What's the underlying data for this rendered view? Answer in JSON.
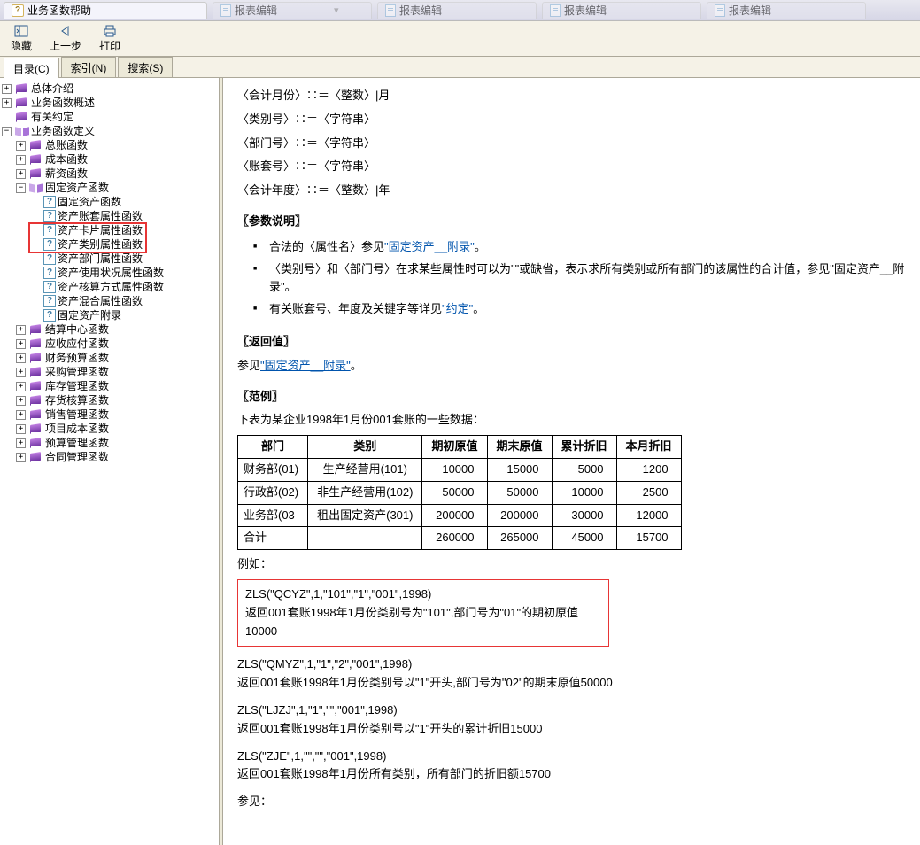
{
  "title": "业务函数帮助",
  "tabs_top": [
    "报表编辑",
    "报表编辑",
    "报表编辑",
    "报表编辑"
  ],
  "toolbar": {
    "hide": "隐藏",
    "back": "上一步",
    "print": "打印"
  },
  "nav_tabs": {
    "toc": "目录(C)",
    "index": "索引(N)",
    "search": "搜索(S)"
  },
  "tree": {
    "n1": "总体介绍",
    "n2": "业务函数概述",
    "n3": "有关约定",
    "n4": "业务函数定义",
    "n4_1": "总账函数",
    "n4_2": "成本函数",
    "n4_3": "薪资函数",
    "n4_4": "固定资产函数",
    "n4_4_1": "固定资产函数",
    "n4_4_2": "资产账套属性函数",
    "n4_4_3": "资产卡片属性函数",
    "n4_4_4": "资产类别属性函数",
    "n4_4_5": "资产部门属性函数",
    "n4_4_6": "资产使用状况属性函数",
    "n4_4_7": "资产核算方式属性函数",
    "n4_4_8": "资产混合属性函数",
    "n4_4_9": "固定资产附录",
    "n4_5": "结算中心函数",
    "n4_6": "应收应付函数",
    "n4_7": "财务预算函数",
    "n4_8": "采购管理函数",
    "n4_9": "库存管理函数",
    "n4_10": "存货核算函数",
    "n4_11": "销售管理函数",
    "n4_12": "项目成本函数",
    "n4_13": "预算管理函数",
    "n4_14": "合同管理函数"
  },
  "content": {
    "def1": "〈会计月份〉∷＝〈整数〉|月",
    "def2": "〈类别号〉∷＝〈字符串〉",
    "def3": "〈部门号〉∷＝〈字符串〉",
    "def4": "〈账套号〉∷＝〈字符串〉",
    "def5": "〈会计年度〉∷＝〈整数〉|年",
    "sec_params": "〖参数说明〗",
    "bullet1_pre": "合法的〈属性名〉参见",
    "bullet1_link": "\"固定资产__附录\"",
    "bullet1_post": "。",
    "bullet2": "〈类别号〉和〈部门号〉在求某些属性时可以为\"\"或缺省，表示求所有类别或所有部门的该属性的合计值，参见\"固定资产__附录\"。",
    "bullet3_pre": "有关账套号、年度及关键字等详见",
    "bullet3_link": "\"约定\"",
    "bullet3_post": "。",
    "sec_return": "〖返回值〗",
    "return_pre": "参见",
    "return_link": "\"固定资产__附录\"",
    "return_post": "。",
    "sec_example": "〖范例〗",
    "example_intro": "下表为某企业1998年1月份001套账的一些数据：",
    "table": {
      "headers": [
        "部门",
        "类别",
        "期初原值",
        "期末原值",
        "累计折旧",
        "本月折旧"
      ],
      "rows": [
        [
          "财务部(01)",
          "生产经营用(101)",
          "10000",
          "15000",
          "5000",
          "1200"
        ],
        [
          "行政部(02)",
          "非生产经营用(102)",
          "50000",
          "50000",
          "10000",
          "2500"
        ],
        [
          "业务部(03",
          "租出固定资产(301)",
          "200000",
          "200000",
          "30000",
          "12000"
        ],
        [
          "合计",
          "",
          "260000",
          "265000",
          "45000",
          "15700"
        ]
      ]
    },
    "eg_label": "例如：",
    "box1_l1": "ZLS(\"QCYZ\",1,\"101\",\"1\",\"001\",1998)",
    "box1_l2": "返回001套账1998年1月份类别号为\"101\",部门号为\"01\"的期初原值10000",
    "ex2_l1": "ZLS(\"QMYZ\",1,\"1\",\"2\",\"001\",1998)",
    "ex2_l2": "返回001套账1998年1月份类别号以\"1\"开头,部门号为\"02\"的期末原值50000",
    "ex3_l1": "ZLS(\"LJZJ\",1,\"1\",\"\",\"001\",1998)",
    "ex3_l2": "返回001套账1998年1月份类别号以\"1\"开头的累计折旧15000",
    "ex4_l1": "ZLS(\"ZJE\",1,\"\",\"\",\"001\",1998)",
    "ex4_l2": "返回001套账1998年1月份所有类别，所有部门的折旧额15700",
    "see_also": "参见："
  }
}
